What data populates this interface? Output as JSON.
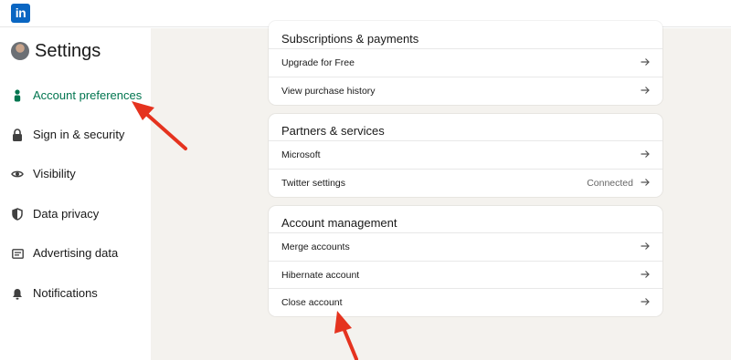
{
  "logo": {
    "text": "in"
  },
  "sidebar": {
    "title": "Settings",
    "items": [
      {
        "label": "Account preferences",
        "icon": "person-icon",
        "active": true
      },
      {
        "label": "Sign in & security",
        "icon": "lock-icon"
      },
      {
        "label": "Visibility",
        "icon": "eye-icon"
      },
      {
        "label": "Data privacy",
        "icon": "shield-icon"
      },
      {
        "label": "Advertising data",
        "icon": "ad-icon"
      },
      {
        "label": "Notifications",
        "icon": "bell-icon"
      }
    ]
  },
  "sections": [
    {
      "title": "Subscriptions & payments",
      "rows": [
        {
          "label": "Upgrade for Free"
        },
        {
          "label": "View purchase history"
        }
      ]
    },
    {
      "title": "Partners & services",
      "rows": [
        {
          "label": "Microsoft"
        },
        {
          "label": "Twitter settings",
          "status": "Connected"
        }
      ]
    },
    {
      "title": "Account management",
      "rows": [
        {
          "label": "Merge accounts"
        },
        {
          "label": "Hibernate account"
        },
        {
          "label": "Close account"
        }
      ]
    }
  ],
  "colors": {
    "brand": "#0a66c2",
    "active_nav": "#01754f",
    "annotation_arrow": "#e5331f",
    "background": "#f4f2ee"
  }
}
